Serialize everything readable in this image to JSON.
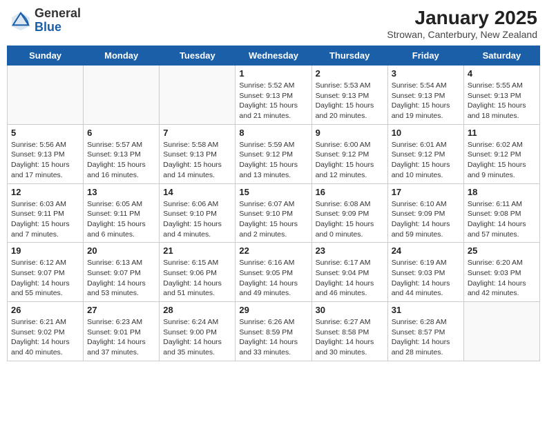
{
  "header": {
    "logo": {
      "general": "General",
      "blue": "Blue"
    },
    "title": "January 2025",
    "subtitle": "Strowan, Canterbury, New Zealand"
  },
  "weekdays": [
    "Sunday",
    "Monday",
    "Tuesday",
    "Wednesday",
    "Thursday",
    "Friday",
    "Saturday"
  ],
  "weeks": [
    [
      {
        "day": "",
        "info": ""
      },
      {
        "day": "",
        "info": ""
      },
      {
        "day": "",
        "info": ""
      },
      {
        "day": "1",
        "info": "Sunrise: 5:52 AM\nSunset: 9:13 PM\nDaylight: 15 hours\nand 21 minutes."
      },
      {
        "day": "2",
        "info": "Sunrise: 5:53 AM\nSunset: 9:13 PM\nDaylight: 15 hours\nand 20 minutes."
      },
      {
        "day": "3",
        "info": "Sunrise: 5:54 AM\nSunset: 9:13 PM\nDaylight: 15 hours\nand 19 minutes."
      },
      {
        "day": "4",
        "info": "Sunrise: 5:55 AM\nSunset: 9:13 PM\nDaylight: 15 hours\nand 18 minutes."
      }
    ],
    [
      {
        "day": "5",
        "info": "Sunrise: 5:56 AM\nSunset: 9:13 PM\nDaylight: 15 hours\nand 17 minutes."
      },
      {
        "day": "6",
        "info": "Sunrise: 5:57 AM\nSunset: 9:13 PM\nDaylight: 15 hours\nand 16 minutes."
      },
      {
        "day": "7",
        "info": "Sunrise: 5:58 AM\nSunset: 9:13 PM\nDaylight: 15 hours\nand 14 minutes."
      },
      {
        "day": "8",
        "info": "Sunrise: 5:59 AM\nSunset: 9:12 PM\nDaylight: 15 hours\nand 13 minutes."
      },
      {
        "day": "9",
        "info": "Sunrise: 6:00 AM\nSunset: 9:12 PM\nDaylight: 15 hours\nand 12 minutes."
      },
      {
        "day": "10",
        "info": "Sunrise: 6:01 AM\nSunset: 9:12 PM\nDaylight: 15 hours\nand 10 minutes."
      },
      {
        "day": "11",
        "info": "Sunrise: 6:02 AM\nSunset: 9:12 PM\nDaylight: 15 hours\nand 9 minutes."
      }
    ],
    [
      {
        "day": "12",
        "info": "Sunrise: 6:03 AM\nSunset: 9:11 PM\nDaylight: 15 hours\nand 7 minutes."
      },
      {
        "day": "13",
        "info": "Sunrise: 6:05 AM\nSunset: 9:11 PM\nDaylight: 15 hours\nand 6 minutes."
      },
      {
        "day": "14",
        "info": "Sunrise: 6:06 AM\nSunset: 9:10 PM\nDaylight: 15 hours\nand 4 minutes."
      },
      {
        "day": "15",
        "info": "Sunrise: 6:07 AM\nSunset: 9:10 PM\nDaylight: 15 hours\nand 2 minutes."
      },
      {
        "day": "16",
        "info": "Sunrise: 6:08 AM\nSunset: 9:09 PM\nDaylight: 15 hours\nand 0 minutes."
      },
      {
        "day": "17",
        "info": "Sunrise: 6:10 AM\nSunset: 9:09 PM\nDaylight: 14 hours\nand 59 minutes."
      },
      {
        "day": "18",
        "info": "Sunrise: 6:11 AM\nSunset: 9:08 PM\nDaylight: 14 hours\nand 57 minutes."
      }
    ],
    [
      {
        "day": "19",
        "info": "Sunrise: 6:12 AM\nSunset: 9:07 PM\nDaylight: 14 hours\nand 55 minutes."
      },
      {
        "day": "20",
        "info": "Sunrise: 6:13 AM\nSunset: 9:07 PM\nDaylight: 14 hours\nand 53 minutes."
      },
      {
        "day": "21",
        "info": "Sunrise: 6:15 AM\nSunset: 9:06 PM\nDaylight: 14 hours\nand 51 minutes."
      },
      {
        "day": "22",
        "info": "Sunrise: 6:16 AM\nSunset: 9:05 PM\nDaylight: 14 hours\nand 49 minutes."
      },
      {
        "day": "23",
        "info": "Sunrise: 6:17 AM\nSunset: 9:04 PM\nDaylight: 14 hours\nand 46 minutes."
      },
      {
        "day": "24",
        "info": "Sunrise: 6:19 AM\nSunset: 9:03 PM\nDaylight: 14 hours\nand 44 minutes."
      },
      {
        "day": "25",
        "info": "Sunrise: 6:20 AM\nSunset: 9:03 PM\nDaylight: 14 hours\nand 42 minutes."
      }
    ],
    [
      {
        "day": "26",
        "info": "Sunrise: 6:21 AM\nSunset: 9:02 PM\nDaylight: 14 hours\nand 40 minutes."
      },
      {
        "day": "27",
        "info": "Sunrise: 6:23 AM\nSunset: 9:01 PM\nDaylight: 14 hours\nand 37 minutes."
      },
      {
        "day": "28",
        "info": "Sunrise: 6:24 AM\nSunset: 9:00 PM\nDaylight: 14 hours\nand 35 minutes."
      },
      {
        "day": "29",
        "info": "Sunrise: 6:26 AM\nSunset: 8:59 PM\nDaylight: 14 hours\nand 33 minutes."
      },
      {
        "day": "30",
        "info": "Sunrise: 6:27 AM\nSunset: 8:58 PM\nDaylight: 14 hours\nand 30 minutes."
      },
      {
        "day": "31",
        "info": "Sunrise: 6:28 AM\nSunset: 8:57 PM\nDaylight: 14 hours\nand 28 minutes."
      },
      {
        "day": "",
        "info": ""
      }
    ]
  ]
}
